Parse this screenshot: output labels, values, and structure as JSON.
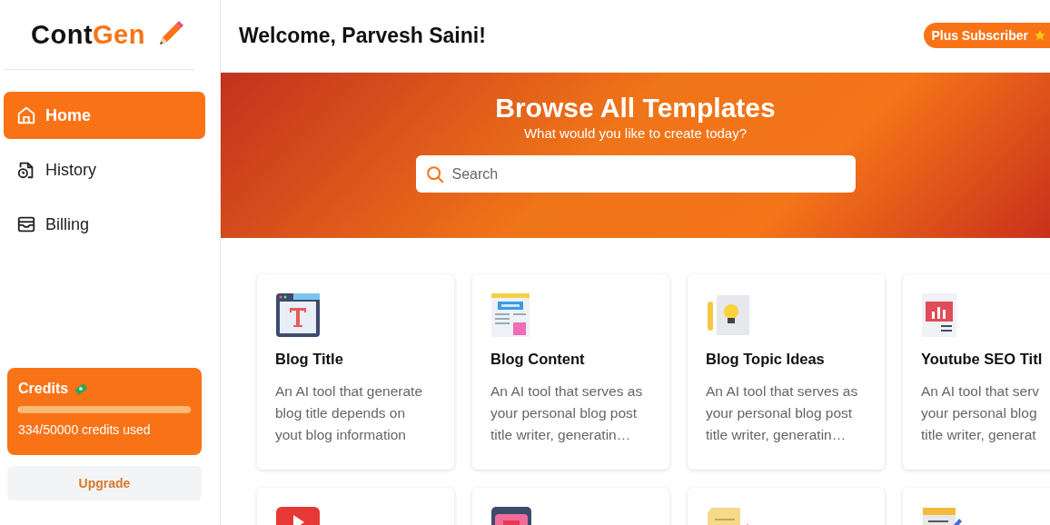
{
  "sidebar": {
    "logo": {
      "dark": "Cont",
      "accent": "Gen"
    },
    "items": [
      {
        "label": "Home",
        "kind": "home",
        "selected": true
      },
      {
        "label": "History",
        "kind": "history",
        "selected": false
      },
      {
        "label": "Billing",
        "kind": "billing",
        "selected": false
      }
    ],
    "credits": {
      "title": "Credits",
      "level": 0.0068,
      "reading": "334/50000 credits used"
    },
    "upgrade": "Upgrade"
  },
  "header": {
    "welcome": "Welcome, Parvesh Saini!",
    "badge": "Plus Subscriber"
  },
  "banner": {
    "title": "Browse All Templates",
    "subtitle": "What would you like to create today?",
    "search": {
      "placeholder": "Search"
    }
  },
  "templates": [
    {
      "kind": "title",
      "name": "Blog Title",
      "description": "An AI tool that generate\nblog title depends on\nyout blog information"
    },
    {
      "kind": "blog",
      "name": "Blog Content",
      "description": "An AI tool that serves as\nyour personal blog post\ntitle writer, generatin…"
    },
    {
      "kind": "idea",
      "name": "Blog Topic Ideas",
      "description": "An AI tool that serves as\nyour personal blog post\ntitle writer, generatin…"
    },
    {
      "kind": "chart",
      "name": "Youtube SEO Titl",
      "description": "An AI tool that serv\nyour personal blog\ntitle writer, generat"
    },
    {
      "kind": "video"
    },
    {
      "kind": "screen"
    },
    {
      "kind": "note"
    },
    {
      "kind": "pad"
    }
  ]
}
